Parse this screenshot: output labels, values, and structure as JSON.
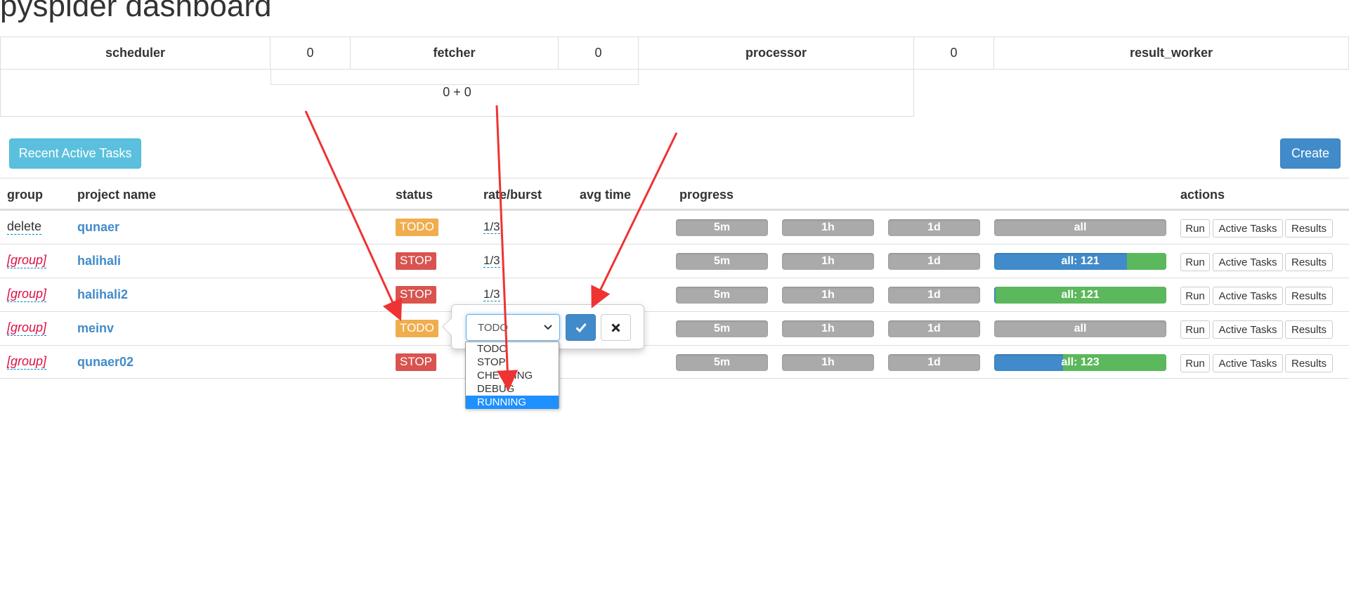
{
  "page": {
    "title": "pyspider dashboard"
  },
  "stats": {
    "scheduler_label": "scheduler",
    "scheduler_value": "0",
    "fetcher_label": "fetcher",
    "fetcher_value": "0",
    "processor_label": "processor",
    "processor_value": "0",
    "result_worker_label": "result_worker",
    "sum": "0 + 0"
  },
  "toolbar": {
    "recent_label": "Recent Active Tasks",
    "create_label": "Create"
  },
  "table": {
    "headers": {
      "group": "group",
      "project_name": "project name",
      "status": "status",
      "rate": "rate/burst",
      "avg_time": "avg time",
      "progress": "progress",
      "actions": "actions"
    },
    "rows": [
      {
        "group": "delete",
        "name": "qunaer",
        "status": "TODO",
        "rate": "1/3",
        "p5m": "5m",
        "p1h": "1h",
        "p1d": "1d",
        "all": "all"
      },
      {
        "group": "[group]",
        "name": "halihali",
        "status": "STOP",
        "rate": "1/3",
        "p5m": "5m",
        "p1h": "1h",
        "p1d": "1d",
        "all": "all: 121"
      },
      {
        "group": "[group]",
        "name": "halihali2",
        "status": "STOP",
        "rate": "1/3",
        "p5m": "5m",
        "p1h": "1h",
        "p1d": "1d",
        "all": "all: 121"
      },
      {
        "group": "[group]",
        "name": "meinv",
        "status": "TODO",
        "rate": "",
        "p5m": "5m",
        "p1h": "1h",
        "p1d": "1d",
        "all": "all"
      },
      {
        "group": "[group]",
        "name": "qunaer02",
        "status": "STOP",
        "rate": "",
        "p5m": "5m",
        "p1h": "1h",
        "p1d": "1d",
        "all": "all: 123"
      }
    ],
    "action_labels": {
      "run": "Run",
      "active_tasks": "Active Tasks",
      "results": "Results"
    }
  },
  "progress_fill": {
    "row1_success_fraction": 0.23,
    "row2_success_fraction": 1.0,
    "row4_success_fraction": 0.6
  },
  "editor": {
    "selected": "TODO",
    "options": [
      "TODO",
      "STOP",
      "CHECKING",
      "DEBUG",
      "RUNNING"
    ],
    "highlighted": "RUNNING"
  },
  "colors": {
    "todo": "#f0ad4e",
    "stop": "#d9534f",
    "progress_gray": "#aaaaaa",
    "progress_blue": "#428bca",
    "progress_green": "#5cb85c",
    "annotation": "#ee3333"
  },
  "icons": {
    "ok": "check-icon",
    "cancel": "close-icon",
    "dropdown": "chevron-down-icon"
  }
}
